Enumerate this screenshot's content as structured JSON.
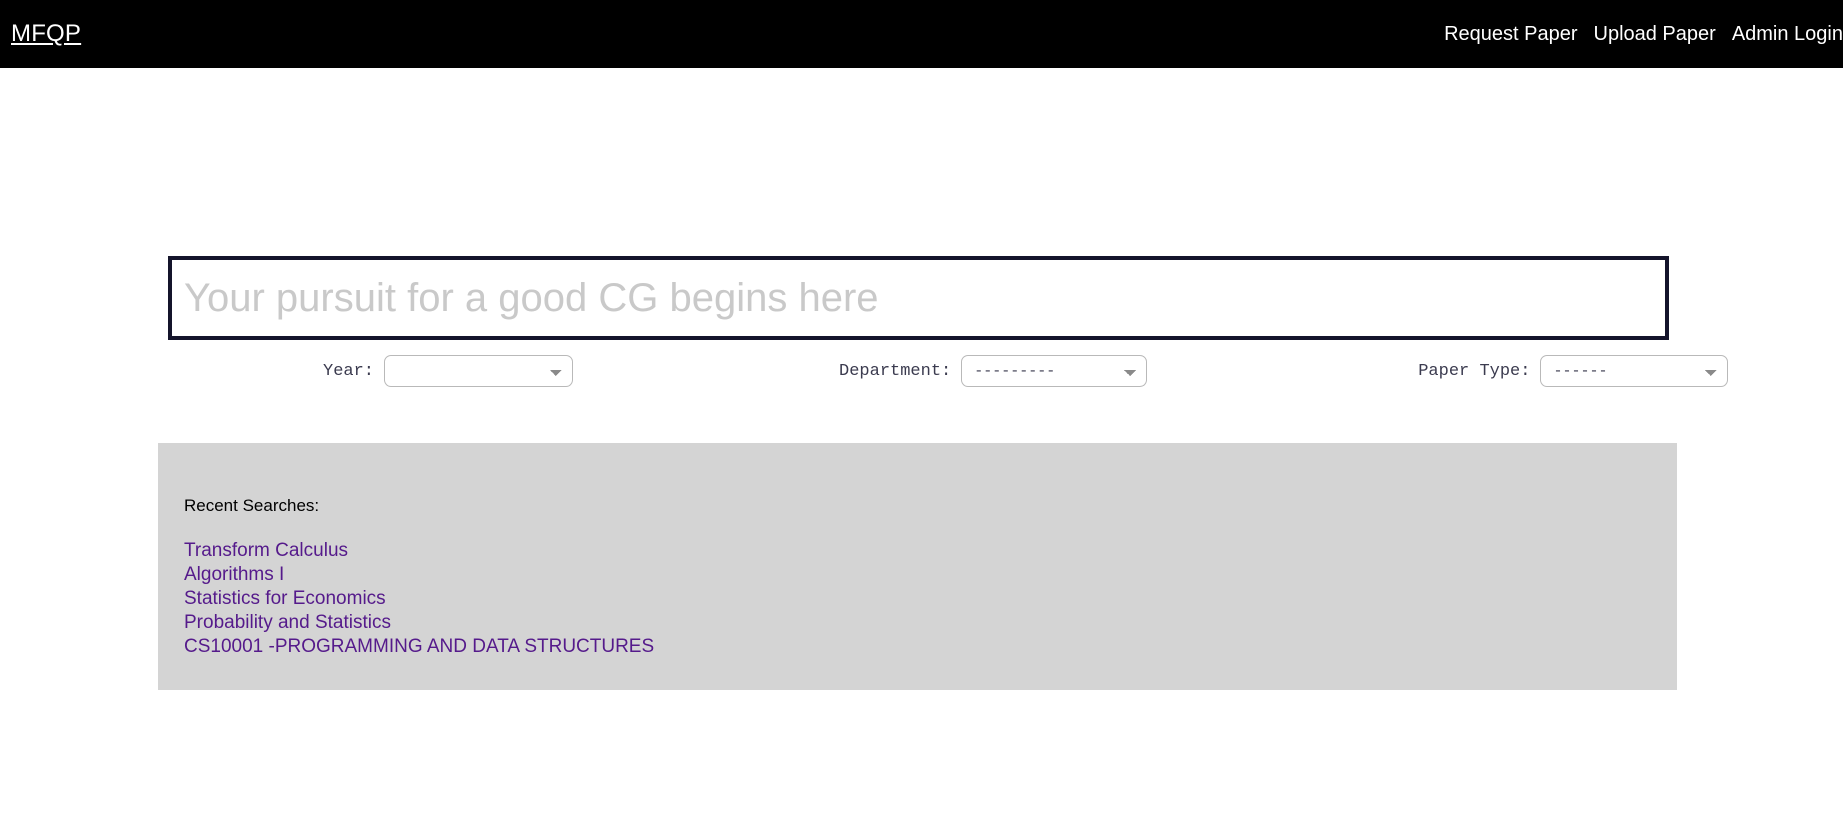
{
  "header": {
    "brand": "MFQP",
    "links": [
      {
        "label": "Request Paper",
        "name": "nav-link-request-paper"
      },
      {
        "label": "Upload Paper",
        "name": "nav-link-upload-paper"
      },
      {
        "label": "Admin Login",
        "name": "nav-link-admin-login"
      }
    ]
  },
  "search": {
    "value": "",
    "placeholder": "Your pursuit for a good CG begins here",
    "border_color": "#14142b"
  },
  "filters": [
    {
      "label": "Year:",
      "selected": ""
    },
    {
      "label": "Department:",
      "selected": "---------"
    },
    {
      "label": "Paper Type:",
      "selected": "------"
    }
  ],
  "recent": {
    "title": "Recent Searches:",
    "background_color": "#d4d4d4",
    "link_color": "#551a8b",
    "items": [
      "Transform Calculus",
      "Algorithms I",
      "Statistics for Economics",
      "Probability and Statistics",
      "CS10001 -PROGRAMMING AND DATA STRUCTURES"
    ]
  }
}
